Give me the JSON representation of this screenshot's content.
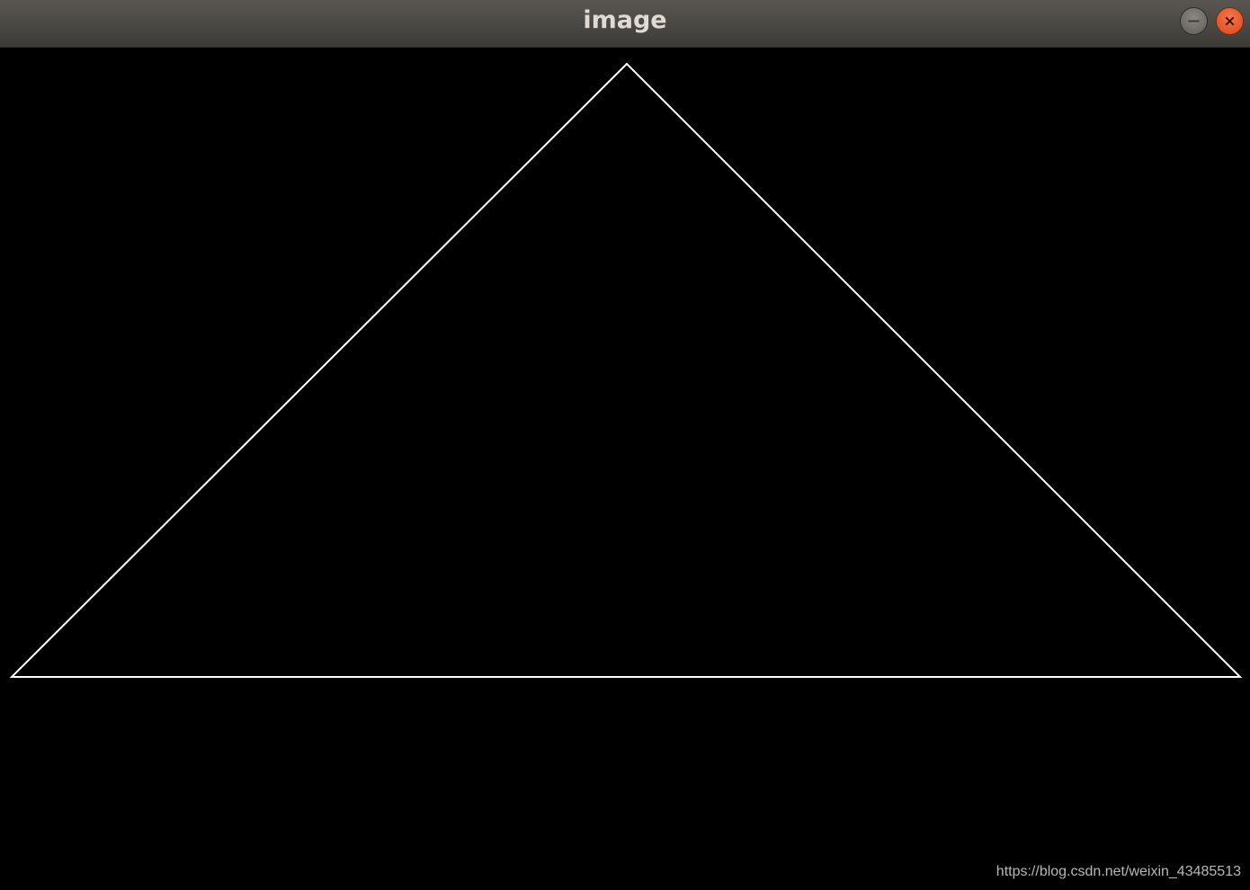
{
  "window": {
    "title": "image",
    "buttons": {
      "minimize_icon": "minimize-icon",
      "close_icon": "close-icon"
    },
    "colors": {
      "titlebar": "#3c3b37",
      "title_text": "#dfdbd2",
      "close_button": "#e95420",
      "canvas_background": "#000000",
      "line": "#ffffff"
    }
  },
  "canvas": {
    "shape": "triangle outline"
  },
  "watermark": {
    "text": "https://blog.csdn.net/weixin_43485513"
  }
}
